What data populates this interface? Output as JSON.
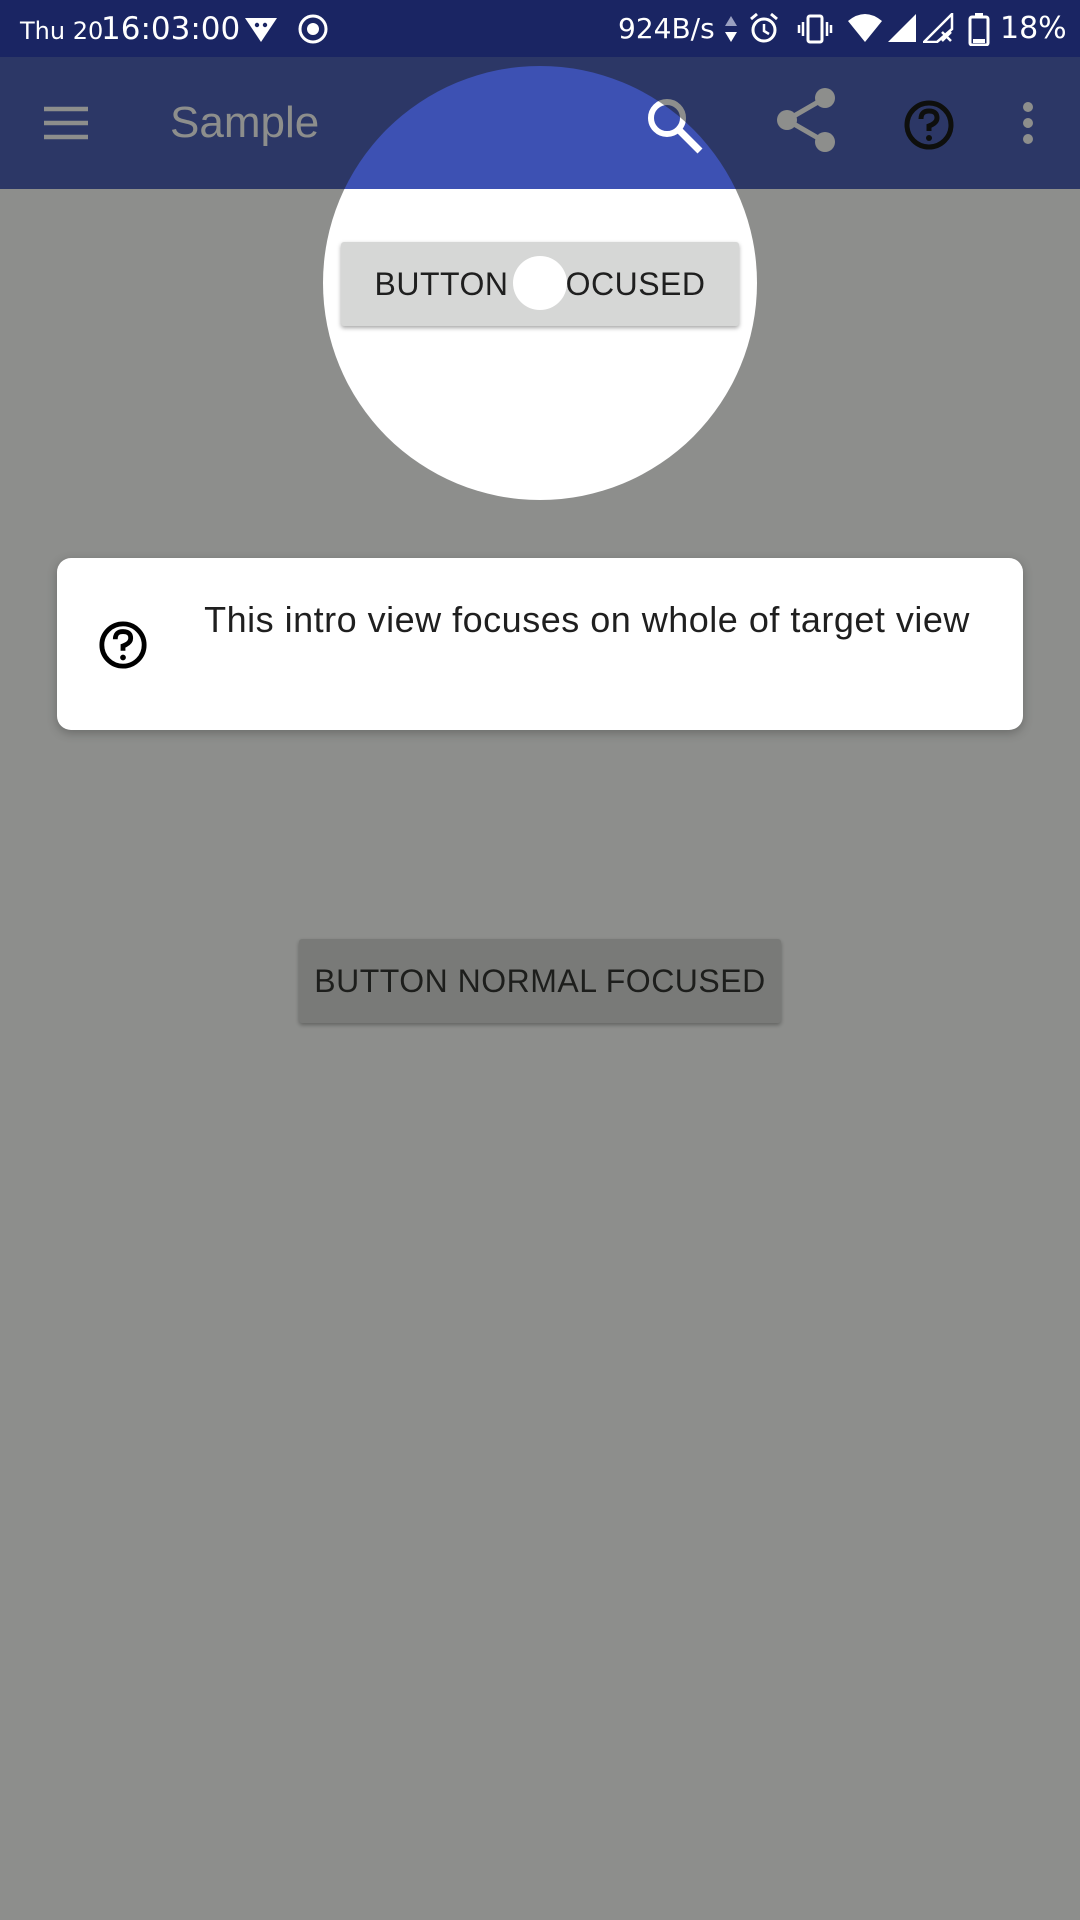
{
  "status_bar": {
    "date": "Thu 20",
    "time": "16:03:00",
    "network_speed": "924B/s",
    "battery_percent": "18%",
    "icons": [
      "vpn-icon",
      "record-icon",
      "data-arrows-icon",
      "alarm-icon",
      "vibrate-icon",
      "wifi-icon",
      "signal-icon",
      "signal-no-data-icon",
      "battery-icon"
    ]
  },
  "app_bar": {
    "title": "Sample",
    "menu_icon": "hamburger-menu-icon",
    "actions": [
      "search-icon",
      "share-icon",
      "help-icon",
      "more-vert-icon"
    ]
  },
  "content": {
    "button_a_label": "BUTTON A FOCUSED",
    "button_normal_label": "BUTTON NORMAL FOCUSED"
  },
  "intro": {
    "icon": "help-icon",
    "text": "This intro view focuses on whole of target view"
  },
  "colors": {
    "status_bar": "#1a2563",
    "app_bar": "#3d51b3",
    "scrim": "rgba(28,30,26,0.5)",
    "button_bg": "#d6d7d6"
  }
}
